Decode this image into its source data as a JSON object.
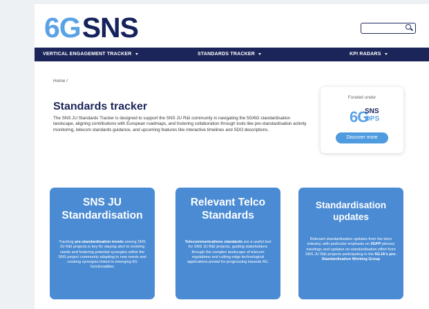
{
  "logo": {
    "six": "6G",
    "sns": "SNS"
  },
  "search": {
    "placeholder": ""
  },
  "nav": {
    "vertical": "VERTICAL ENGAGEMENT TRACKER",
    "standards": "STANDARDS TRACKER",
    "kpi": "KPI RADARS"
  },
  "breadcrumb": "Home /",
  "title": "Standards tracker",
  "intro": "The SNS JU Standards Tracker is designed to support the SNS JU R&I community in navigating the 5G/6G standardisation landscape, aligning contributions with European roadmaps, and fostering collaboration through tools like pre-standardisation activity monitoring, telecom standards guidance, and upcoming features like interactive timelines and SDO descriptions.",
  "funded": {
    "label": "Funded under",
    "logo_six": "6G",
    "logo_sns": "SNS",
    "logo_ops": "OPS",
    "button": "Discover more"
  },
  "cards": [
    {
      "title_line1": "SNS JU",
      "title_line2": "Standardisation",
      "desc_pre": "Tracking ",
      "desc_bold": "pre-standardisation trends",
      "desc_post": " among SNS JU R&I projects is key for staying alert to evolving needs and fostering potential synergies within the SNS project community adapting to new needs and creating synergies linked to emerging 6G functionalities"
    },
    {
      "title_line1": "Relevant Telco",
      "title_line2": "Standards",
      "desc_bold": "Telecommunications standards",
      "desc_post": " are a useful tool for SNS JU R&I projects, guiding stakeholders through the complex landscape of telecom regulations and cutting-edge technological applications pivotal for progressing towards 6G."
    },
    {
      "title_line1": "Standardisation",
      "title_line2": "updates",
      "desc_pre": "Relevant standardisation updates from the telco industry, with particular emphasis on ",
      "desc_bold": "3GPP",
      "desc_mid": " plenary meetings and updates on standardisation effort from SNS JU R&I projects participating in the ",
      "desc_bold2": "6G-IA's pre-Standardisation Working Group"
    }
  ],
  "colors": {
    "navy": "#1b2559",
    "card_blue": "#4a8bd3",
    "light_blue": "#5aa2e6"
  }
}
